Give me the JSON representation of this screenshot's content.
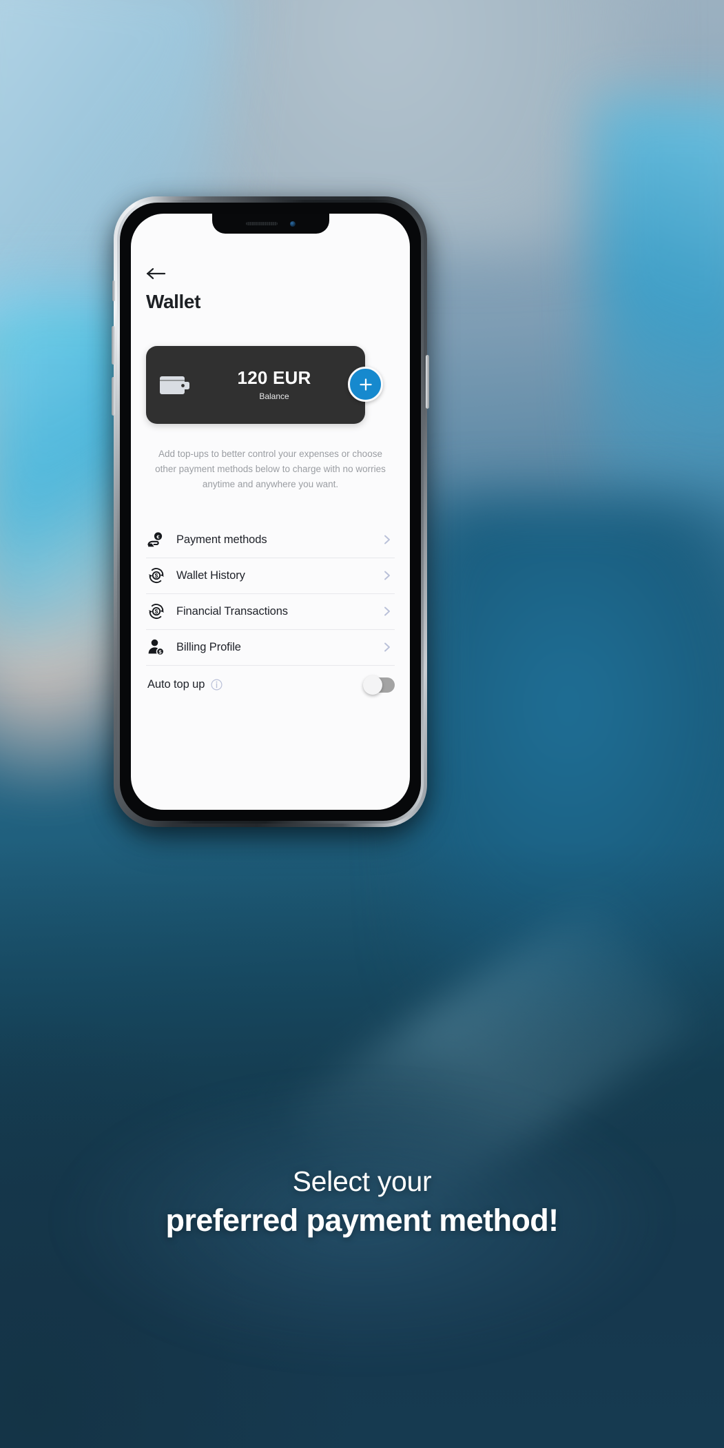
{
  "background": {
    "accent_blue": "#1689ce",
    "page_bottom": "#16384e"
  },
  "phone": {
    "status_notch": {
      "speaker": "speaker-grille",
      "camera": "front-camera"
    }
  },
  "app": {
    "back_label": "back-arrow",
    "title": "Wallet",
    "balance_card": {
      "icon": "wallet-icon",
      "amount": "120 EUR",
      "label": "Balance",
      "card_color": "#303030",
      "add_button": {
        "icon": "plus-icon",
        "color": "#1689ce"
      }
    },
    "description": "Add top-ups to better control your expenses or choose other payment methods below to charge with no worries anytime and anywhere you want.",
    "menu": [
      {
        "label": "Payment methods",
        "icon": "hand-euro-coin-icon",
        "chevron": "chevron-right-icon"
      },
      {
        "label": "Wallet History",
        "icon": "refresh-dollar-icon",
        "chevron": "chevron-right-icon"
      },
      {
        "label": "Financial Transactions",
        "icon": "refresh-dollar-icon",
        "chevron": "chevron-right-icon"
      },
      {
        "label": "Billing Profile",
        "icon": "person-dollar-icon",
        "chevron": "chevron-right-icon"
      }
    ],
    "auto_top_up": {
      "label": "Auto top up",
      "info_icon": "info-icon",
      "toggle_state": "off"
    }
  },
  "caption": {
    "line1": "Select your",
    "line2": "preferred payment method!"
  }
}
